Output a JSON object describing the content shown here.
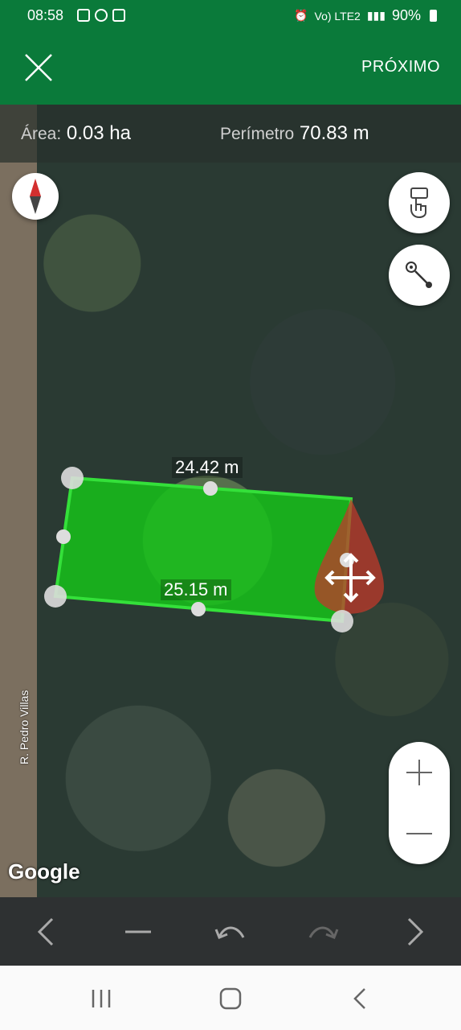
{
  "status_bar": {
    "time": "08:58",
    "battery": "90%",
    "network_label": "Vo) LTE2"
  },
  "app_bar": {
    "next_label": "PRÓXIMO"
  },
  "info": {
    "area_label": "Área:",
    "area_value": "0.03 ha",
    "perimeter_label": "Perímetro",
    "perimeter_value": "70.83 m"
  },
  "map": {
    "road_label": "R. Pedro Villas",
    "provider_label": "Google",
    "measure_top": "24.42 m",
    "measure_bottom": "25.15 m",
    "polygon_fill": "#16c21a",
    "polygon_stroke": "#34e03a"
  },
  "icons": {
    "close": "close-icon",
    "compass": "compass-icon",
    "hand": "hand-tap-icon",
    "move_point": "point-move-icon",
    "zoom_in": "plus-icon",
    "zoom_out": "minus-icon",
    "prev": "chevron-left-icon",
    "remove": "minus-icon",
    "undo": "undo-icon",
    "redo": "redo-icon",
    "next": "chevron-right-icon"
  },
  "colors": {
    "primary": "#0a7a3a",
    "toolbar": "#2e3132"
  }
}
